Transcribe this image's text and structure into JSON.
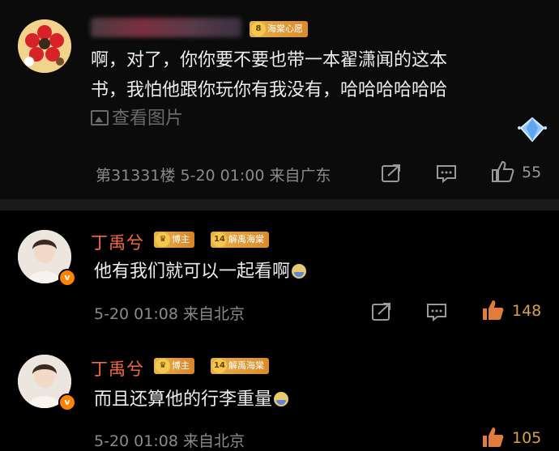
{
  "comments": [
    {
      "username_hidden": true,
      "fan_badge": {
        "level": "8",
        "label": "海棠心愿"
      },
      "text": "啊，对了，你你要不要也带一本翟潇闻的这本书，我怕他跟你玩你有我没有，哈哈哈哈哈哈",
      "text_line1": "啊，对了，你你要不要也带一本翟潇闻的这本",
      "text_line2": "书，我怕他跟你玩你有我没有，哈哈哈哈哈哈",
      "view_pic": "查看图片",
      "floor": "第31331楼",
      "time": "5-20 01:00",
      "location": "来自广东",
      "likes": "55"
    },
    {
      "username": "丁禹兮",
      "blogger_badge": "博主",
      "fan_badge": {
        "level": "14",
        "label": "解禹海棠"
      },
      "text": "他有我们就可以一起看啊",
      "time": "5-20 01:08",
      "location": "来自北京",
      "likes": "148",
      "verified": "v"
    },
    {
      "username": "丁禹兮",
      "blogger_badge": "博主",
      "fan_badge": {
        "level": "14",
        "label": "解禹海棠"
      },
      "text": "而且还算他的行李重量",
      "time": "5-20 01:08",
      "location": "来自北京",
      "likes": "105",
      "verified": "v"
    }
  ],
  "colors": {
    "username": "#f26c44",
    "like_hot": "#d3a34a",
    "badge": "#e7b04a"
  },
  "icons": [
    "share-icon",
    "comment-icon",
    "like-icon",
    "picture-icon",
    "diamond-icon",
    "verified-icon",
    "emoji-icon"
  ]
}
